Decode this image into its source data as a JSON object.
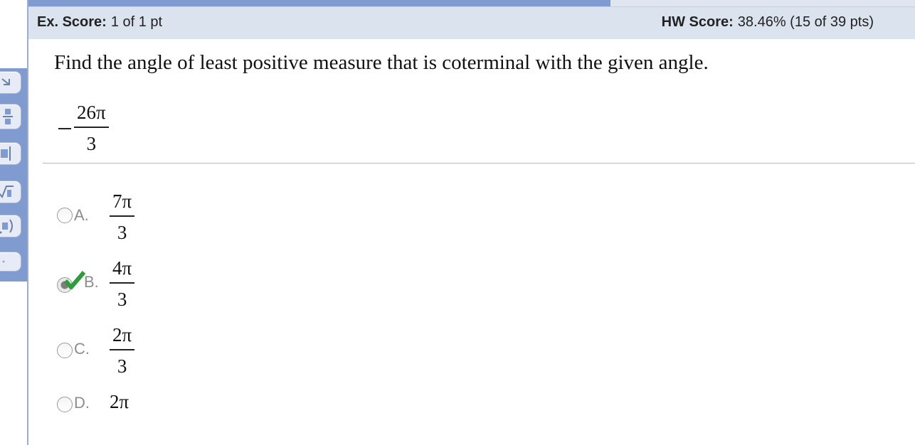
{
  "header": {
    "ex_score_label": "Ex. Score:",
    "ex_score_value": "1 of 1 pt",
    "hw_score_label": "HW Score:",
    "hw_score_value": "38.46% (15 of 39 pts)"
  },
  "question": {
    "prompt": "Find the angle of least positive measure that is coterminal with the given angle.",
    "given_angle": {
      "sign": "−",
      "numerator": "26π",
      "denominator": "3"
    }
  },
  "options": [
    {
      "letter": "A.",
      "numerator": "7π",
      "denominator": "3",
      "selected": false
    },
    {
      "letter": "B.",
      "numerator": "4π",
      "denominator": "3",
      "selected": true,
      "marked_correct": true
    },
    {
      "letter": "C.",
      "numerator": "2π",
      "denominator": "3",
      "selected": false
    },
    {
      "letter": "D.",
      "value": "2π",
      "selected": false
    }
  ],
  "tools": [
    {
      "icon": "maximize-icon"
    },
    {
      "icon": "fraction-icon"
    },
    {
      "icon": "mixed-number-icon"
    },
    {
      "icon": "square-root-icon"
    },
    {
      "icon": "parenthesis-icon"
    },
    {
      "icon": "more-tools-icon"
    }
  ],
  "colors": {
    "header_bg": "#dbe3ef",
    "palette_bg": "#7f9bd0",
    "check_green": "#2e9c3a"
  }
}
